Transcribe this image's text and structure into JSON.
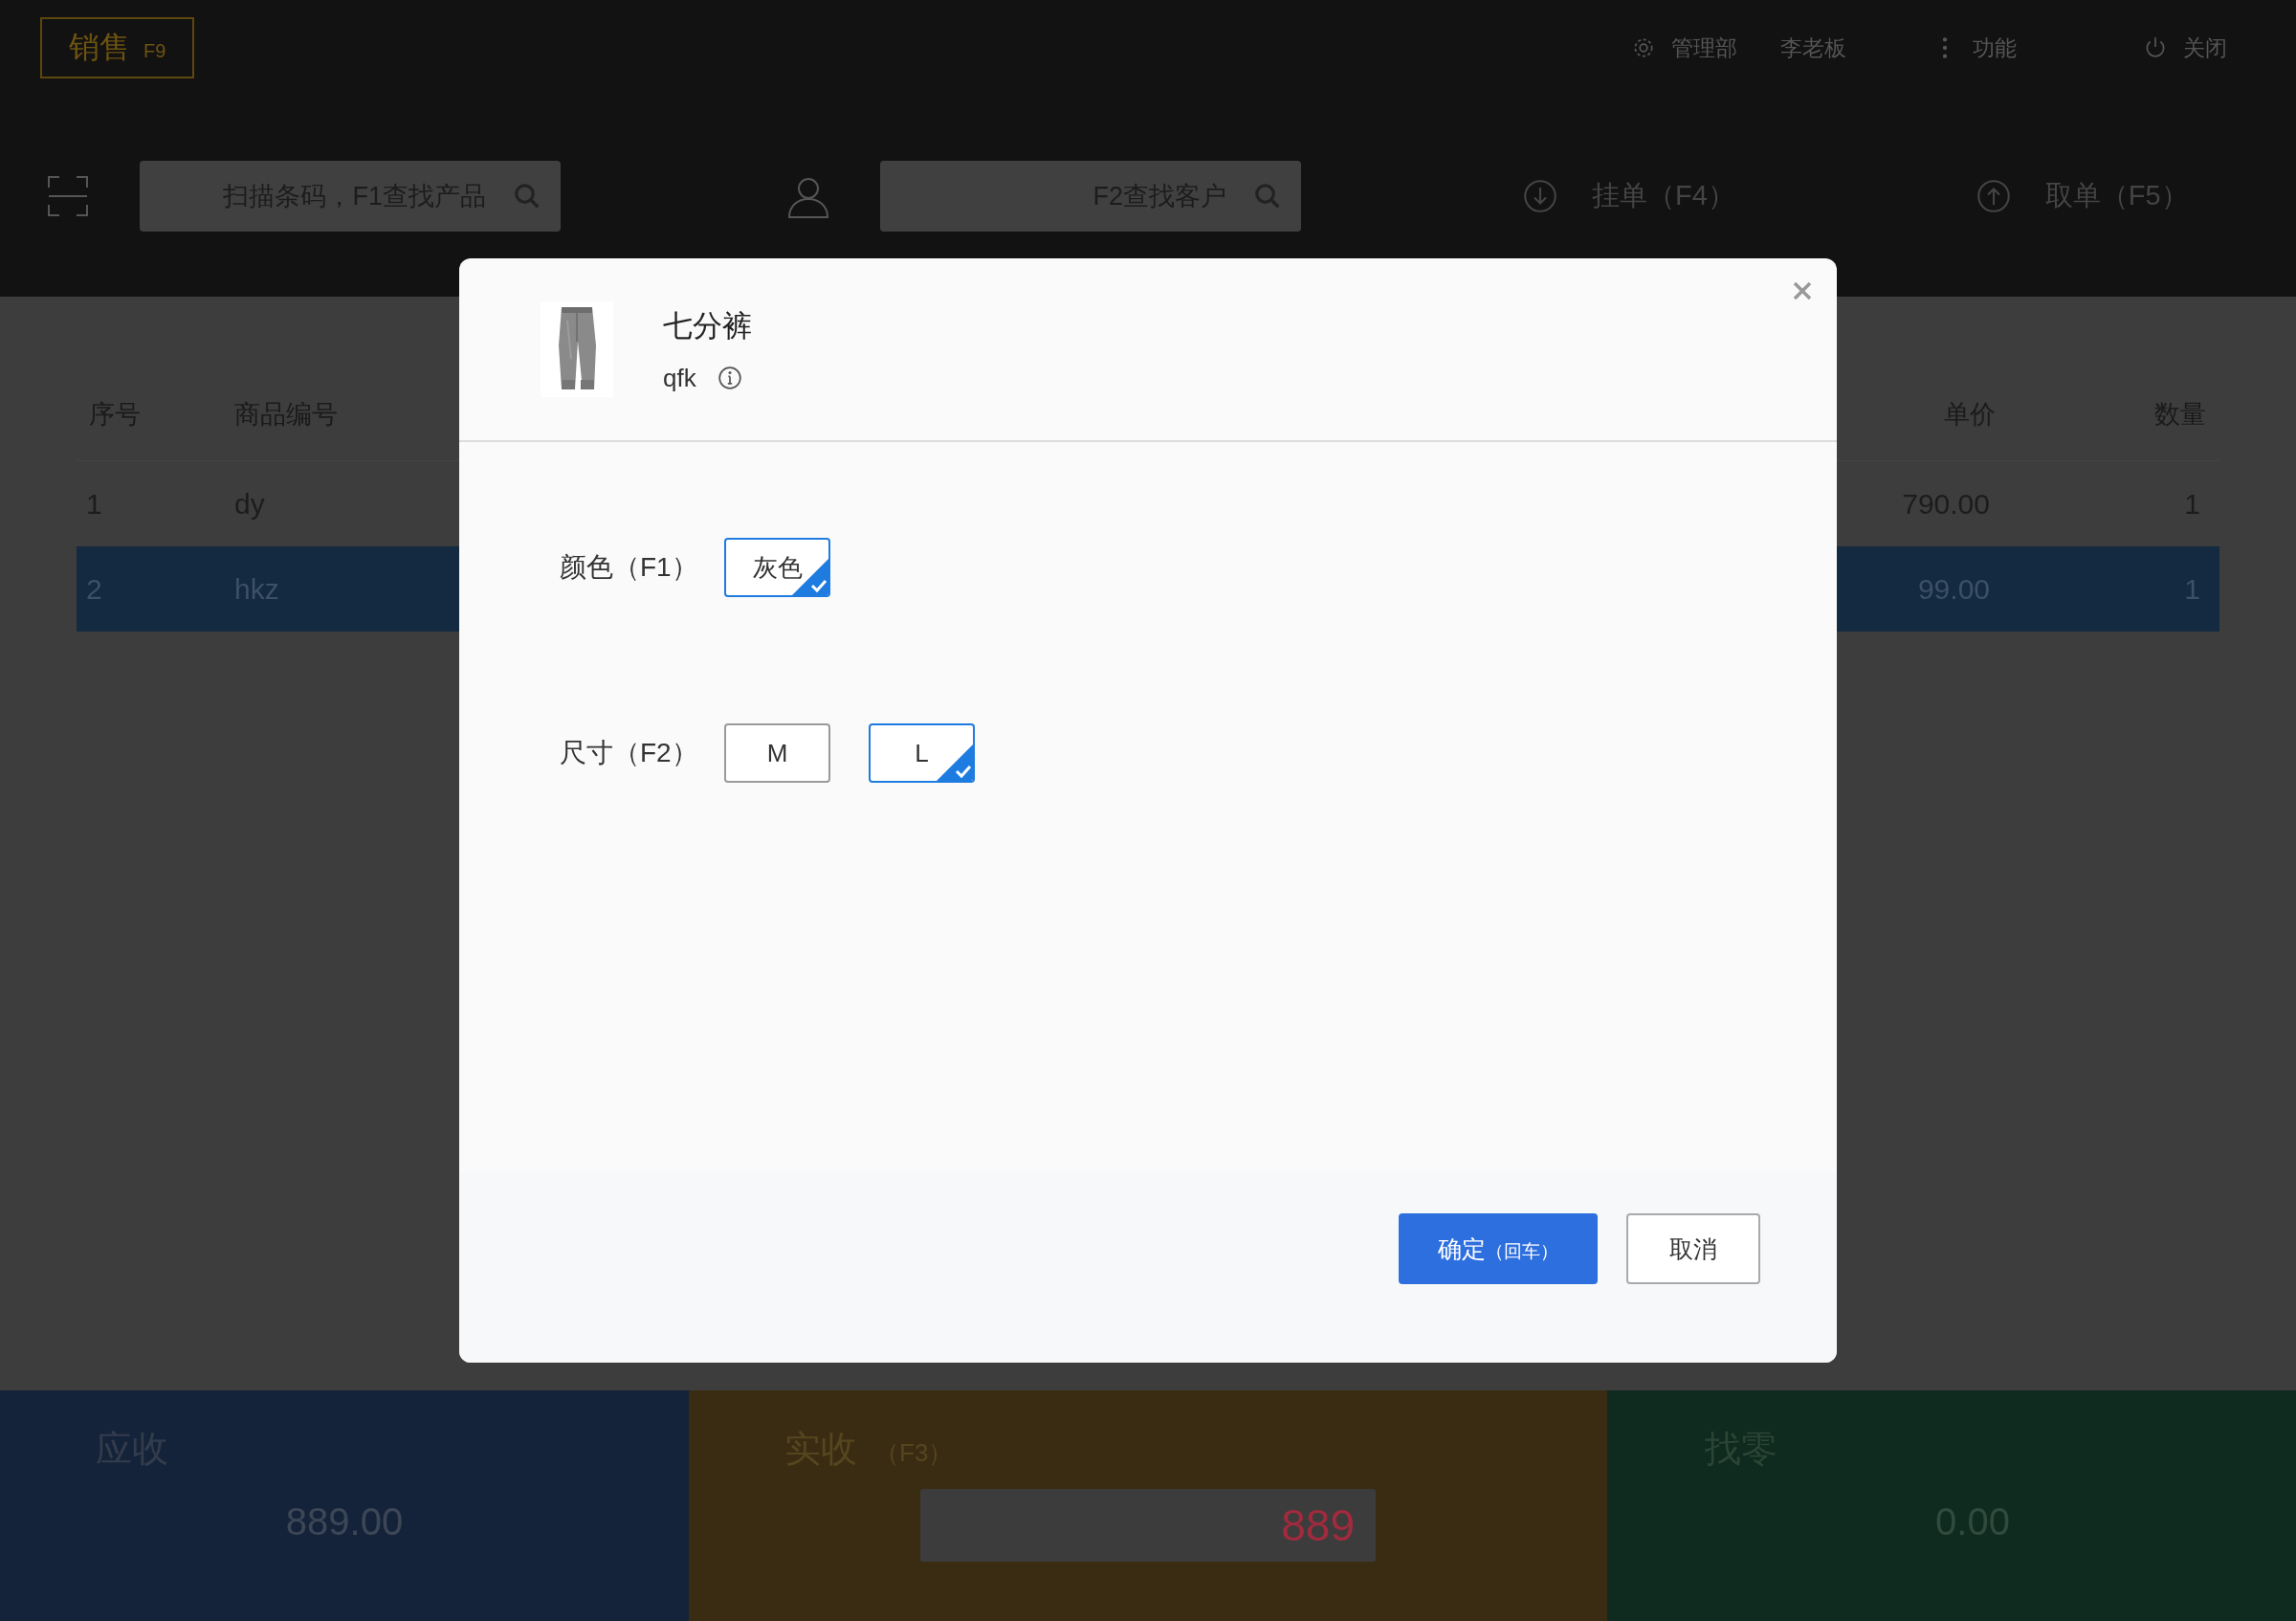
{
  "app_badge": {
    "label": "销售",
    "key": "F9"
  },
  "header_menu": [
    {
      "kind": "settings",
      "label": "管理部"
    },
    {
      "kind": "text",
      "label": "李老板"
    },
    {
      "kind": "more",
      "label": "功能"
    },
    {
      "kind": "power",
      "label": "关闭"
    }
  ],
  "toolbar": {
    "scan_field": {
      "placeholder": "扫描条码，F1查找产品"
    },
    "customer_field": {
      "placeholder": "F2查找客户"
    },
    "actions": [
      {
        "kind": "down",
        "label": "挂单（F4）"
      },
      {
        "kind": "up",
        "label": "取单（F5）"
      }
    ]
  },
  "table": {
    "columns": [
      "序号",
      "商品编号",
      "单价",
      "数量"
    ],
    "rows": [
      {
        "cells": [
          "1",
          "dy",
          "790.00",
          "1"
        ],
        "selected": false
      },
      {
        "cells": [
          "2",
          "hkz",
          "99.00",
          "1"
        ],
        "selected": true
      }
    ]
  },
  "summary": {
    "due": {
      "label": "应收",
      "amount": "889.00"
    },
    "received": {
      "label": "实收",
      "key": "（F3）",
      "value": "889"
    },
    "change": {
      "label": "找零",
      "amount": "0.00"
    }
  },
  "dialog": {
    "product": {
      "name": "七分裤",
      "code": "qfk"
    },
    "options": [
      {
        "label": "颜色（F1）",
        "values": [
          {
            "label": "灰色",
            "selected": true
          }
        ]
      },
      {
        "label": "尺寸（F2）",
        "values": [
          {
            "label": "M",
            "selected": false
          },
          {
            "label": "L",
            "selected": true
          }
        ]
      }
    ],
    "buttons": [
      {
        "kind": "primary",
        "label": "确定",
        "hint": "（回车）"
      },
      {
        "kind": "secondary",
        "label": "取消"
      }
    ]
  }
}
